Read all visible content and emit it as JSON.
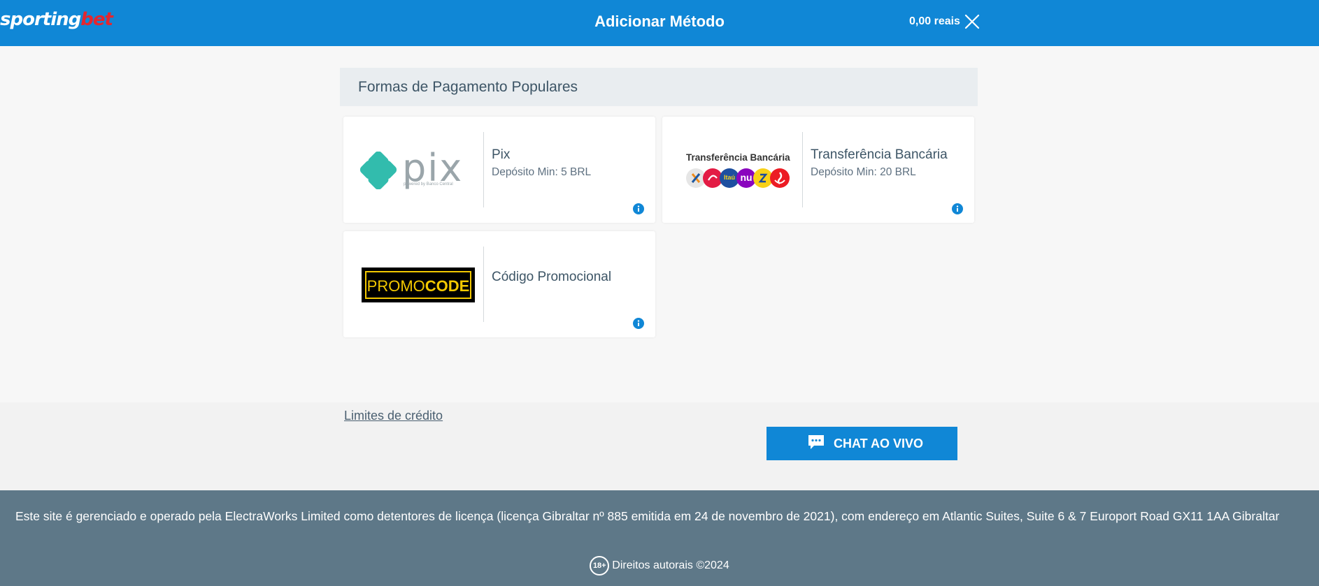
{
  "header": {
    "logo_part1": "sporting",
    "logo_part2": "bet",
    "title": "Adicionar Método",
    "balance": "0,00 reais",
    "close_icon": "close-icon"
  },
  "section": {
    "title": "Formas de Pagamento Populares"
  },
  "methods": {
    "pix": {
      "name": "Pix",
      "min": "Depósito Min: 5 BRL",
      "logo_word": "pix",
      "logo_tagline": "powered by Banco Central",
      "info_icon": "info-icon"
    },
    "bank": {
      "name": "Transferência Bancária",
      "min": "Depósito Min: 20 BRL",
      "logo_text": "Transferência Bancária",
      "bank_icons": [
        "caixa-icon",
        "bradesco-icon",
        "itau-icon",
        "nubank-icon",
        "banco-do-brasil-icon",
        "santander-icon"
      ],
      "itau_label": "Itaú",
      "nu_label": "nu",
      "info_icon": "info-icon"
    },
    "promo": {
      "name": "Código Promocional",
      "logo_part1": "PROMO",
      "logo_part2": "CODE",
      "info_icon": "info-icon"
    }
  },
  "bottom": {
    "credit_limits": "Limites de crédito",
    "chat_label": "CHAT AO VIVO",
    "chat_icon": "chat-bubble-icon"
  },
  "footer": {
    "text": "Este site é gerenciado e operado pela ElectraWorks Limited como detentores de licença (licença Gibraltar nº 885 emitida em 24 de novembro de 2021), com endereço em Atlantic Suites, Suite 6 & 7 Europort Road GX11 1AA Gibraltar",
    "age": "18+",
    "copyright": "Direitos autorais  ©2024"
  },
  "colors": {
    "brand_blue": "#1087d6",
    "logo_red": "#e3262f",
    "footer_bg": "#5e7888",
    "pix_teal": "#32bcad",
    "promo_yellow": "#f3c800"
  }
}
